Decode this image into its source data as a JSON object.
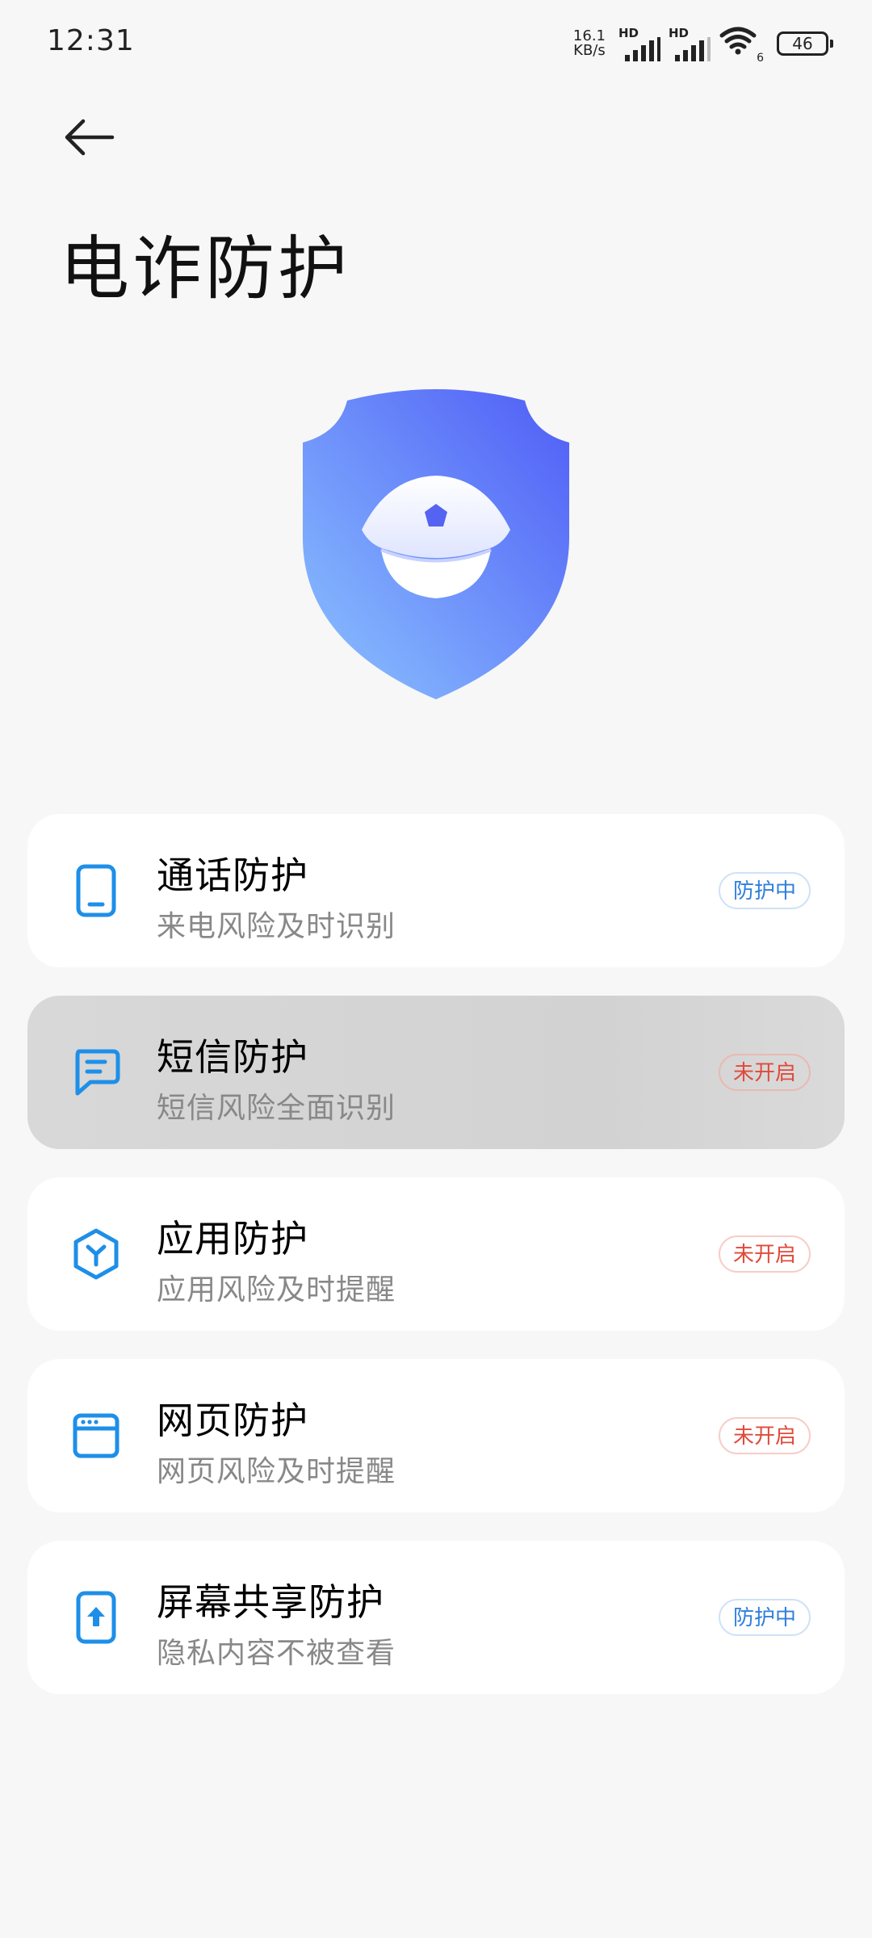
{
  "status_bar": {
    "time": "12:31",
    "net_speed_value": "16.1",
    "net_speed_unit": "KB/s",
    "sim1_label": "HD",
    "sim2_label": "HD",
    "wifi_label": "6",
    "battery": "46"
  },
  "header": {
    "title": "电诈防护"
  },
  "items": [
    {
      "title": "通话防护",
      "subtitle": "来电风险及时识别",
      "status": "防护中"
    },
    {
      "title": "短信防护",
      "subtitle": "短信风险全面识别",
      "status": "未开启"
    },
    {
      "title": "应用防护",
      "subtitle": "应用风险及时提醒",
      "status": "未开启"
    },
    {
      "title": "网页防护",
      "subtitle": "网页风险及时提醒",
      "status": "未开启"
    },
    {
      "title": "屏幕共享防护",
      "subtitle": "隐私内容不被查看",
      "status": "防护中"
    }
  ],
  "colors": {
    "accent": "#1e8fe8",
    "status_on": "#2f7fdc",
    "status_off": "#e04a3a",
    "shield_start": "#86b8ff",
    "shield_end": "#5a67f7"
  }
}
